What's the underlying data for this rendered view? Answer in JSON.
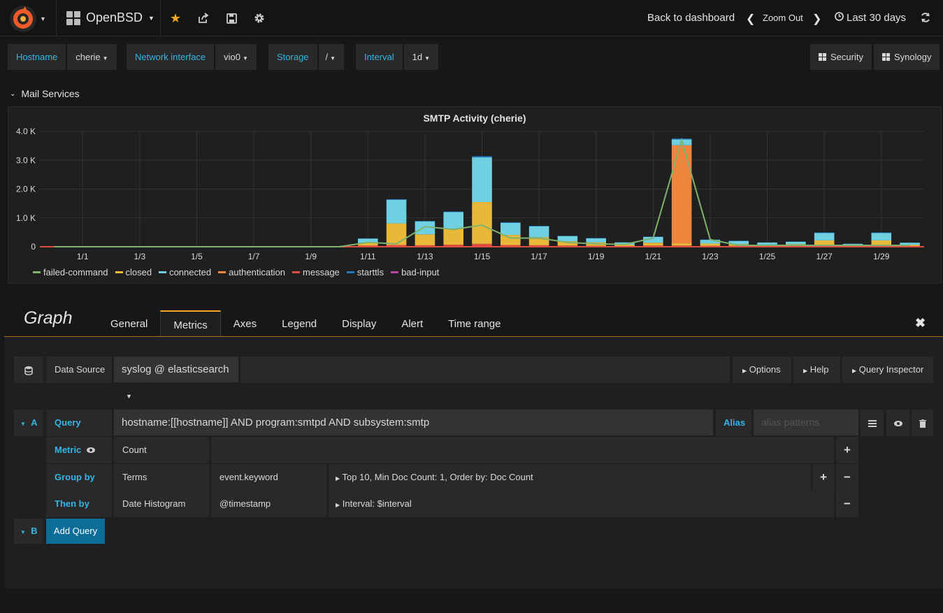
{
  "nav": {
    "dashboard_title": "OpenBSD",
    "back_to_dashboard": "Back to dashboard",
    "zoom_out": "Zoom Out",
    "time_range": "Last 30 days"
  },
  "variables": [
    {
      "label": "Hostname",
      "value": "cherie"
    },
    {
      "label": "Network interface",
      "value": "vio0"
    },
    {
      "label": "Storage",
      "value": "/"
    },
    {
      "label": "Interval",
      "value": "1d"
    }
  ],
  "dashboard_links": [
    "Security",
    "Synology"
  ],
  "row": {
    "title": "Mail Services"
  },
  "chart_data": {
    "type": "bar",
    "title": "SMTP Activity (cherie)",
    "y_ticks": [
      "0",
      "1.0 K",
      "2.0 K",
      "3.0 K",
      "4.0 K"
    ],
    "ylim": [
      0,
      4000
    ],
    "x_tick_labels": [
      "1/1",
      "1/3",
      "1/5",
      "1/7",
      "1/9",
      "1/11",
      "1/13",
      "1/15",
      "1/17",
      "1/19",
      "1/21",
      "1/23",
      "1/25",
      "1/27",
      "1/29"
    ],
    "stacked": true,
    "categories": [
      "12/31",
      "1/1",
      "1/2",
      "1/3",
      "1/4",
      "1/5",
      "1/6",
      "1/7",
      "1/8",
      "1/9",
      "1/10",
      "1/11",
      "1/12",
      "1/13",
      "1/14",
      "1/15",
      "1/16",
      "1/17",
      "1/18",
      "1/19",
      "1/20",
      "1/21",
      "1/22",
      "1/23",
      "1/24",
      "1/25",
      "1/26",
      "1/27",
      "1/28",
      "1/29",
      "1/30"
    ],
    "series": [
      {
        "name": "failed-command",
        "color": "#7eb26d",
        "render": "line",
        "values": [
          0,
          0,
          0,
          0,
          0,
          0,
          0,
          0,
          0,
          0,
          0,
          150,
          100,
          700,
          600,
          750,
          300,
          300,
          150,
          100,
          80,
          300,
          3700,
          250,
          50,
          50,
          50,
          50,
          50,
          50,
          50
        ]
      },
      {
        "name": "closed",
        "color": "#eab839",
        "values": [
          0,
          0,
          0,
          0,
          0,
          0,
          0,
          0,
          0,
          0,
          0,
          100,
          750,
          380,
          550,
          1450,
          350,
          280,
          150,
          120,
          50,
          100,
          80,
          80,
          60,
          50,
          60,
          180,
          30,
          180,
          50
        ]
      },
      {
        "name": "connected",
        "color": "#6ed0e0",
        "values": [
          0,
          0,
          0,
          0,
          0,
          0,
          0,
          0,
          0,
          0,
          0,
          140,
          820,
          450,
          580,
          1550,
          420,
          380,
          180,
          140,
          80,
          200,
          200,
          130,
          110,
          70,
          80,
          260,
          50,
          260,
          70
        ]
      },
      {
        "name": "authentication",
        "color": "#ef843c",
        "values": [
          0,
          0,
          0,
          0,
          0,
          0,
          0,
          0,
          0,
          0,
          0,
          0,
          0,
          0,
          0,
          0,
          0,
          0,
          0,
          0,
          0,
          0,
          3400,
          0,
          0,
          0,
          0,
          0,
          0,
          0,
          0
        ]
      },
      {
        "name": "message",
        "color": "#e24d42",
        "values": [
          0,
          0,
          0,
          0,
          0,
          0,
          0,
          0,
          0,
          0,
          0,
          40,
          60,
          50,
          70,
          100,
          60,
          50,
          40,
          30,
          20,
          40,
          40,
          30,
          30,
          25,
          30,
          40,
          20,
          40,
          20
        ]
      },
      {
        "name": "starttls",
        "color": "#1f78c1",
        "values": [
          0,
          0,
          0,
          0,
          0,
          0,
          0,
          0,
          0,
          0,
          0,
          10,
          20,
          15,
          20,
          40,
          20,
          15,
          10,
          10,
          5,
          10,
          30,
          10,
          10,
          5,
          10,
          15,
          5,
          15,
          5
        ]
      },
      {
        "name": "bad-input",
        "color": "#ba43a9",
        "values": [
          0,
          0,
          0,
          0,
          0,
          0,
          0,
          0,
          0,
          0,
          0,
          0,
          0,
          0,
          0,
          0,
          0,
          0,
          0,
          0,
          0,
          0,
          0,
          0,
          0,
          0,
          0,
          0,
          0,
          0,
          0
        ]
      }
    ]
  },
  "editor": {
    "title": "Graph",
    "tabs": [
      "General",
      "Metrics",
      "Axes",
      "Legend",
      "Display",
      "Alert",
      "Time range"
    ],
    "active_tab": "Metrics",
    "data_source_label": "Data Source",
    "data_source_value": "syslog @ elasticsearch",
    "options_label": "Options",
    "help_label": "Help",
    "query_inspector_label": "Query Inspector",
    "query_a": {
      "letter": "A",
      "query_label": "Query",
      "query_value": "hostname:[[hostname]] AND program:smtpd AND subsystem:smtp",
      "alias_label": "Alias",
      "alias_placeholder": "alias patterns",
      "metric_label": "Metric",
      "metric_value": "Count",
      "group_by_label": "Group by",
      "group_by_type": "Terms",
      "group_by_field": "event.keyword",
      "group_by_options": "Top 10, Min Doc Count: 1, Order by: Doc Count",
      "then_by_label": "Then by",
      "then_by_type": "Date Histogram",
      "then_by_field": "@timestamp",
      "then_by_options": "Interval: $interval"
    },
    "query_b": {
      "letter": "B"
    },
    "add_query_label": "Add Query"
  }
}
